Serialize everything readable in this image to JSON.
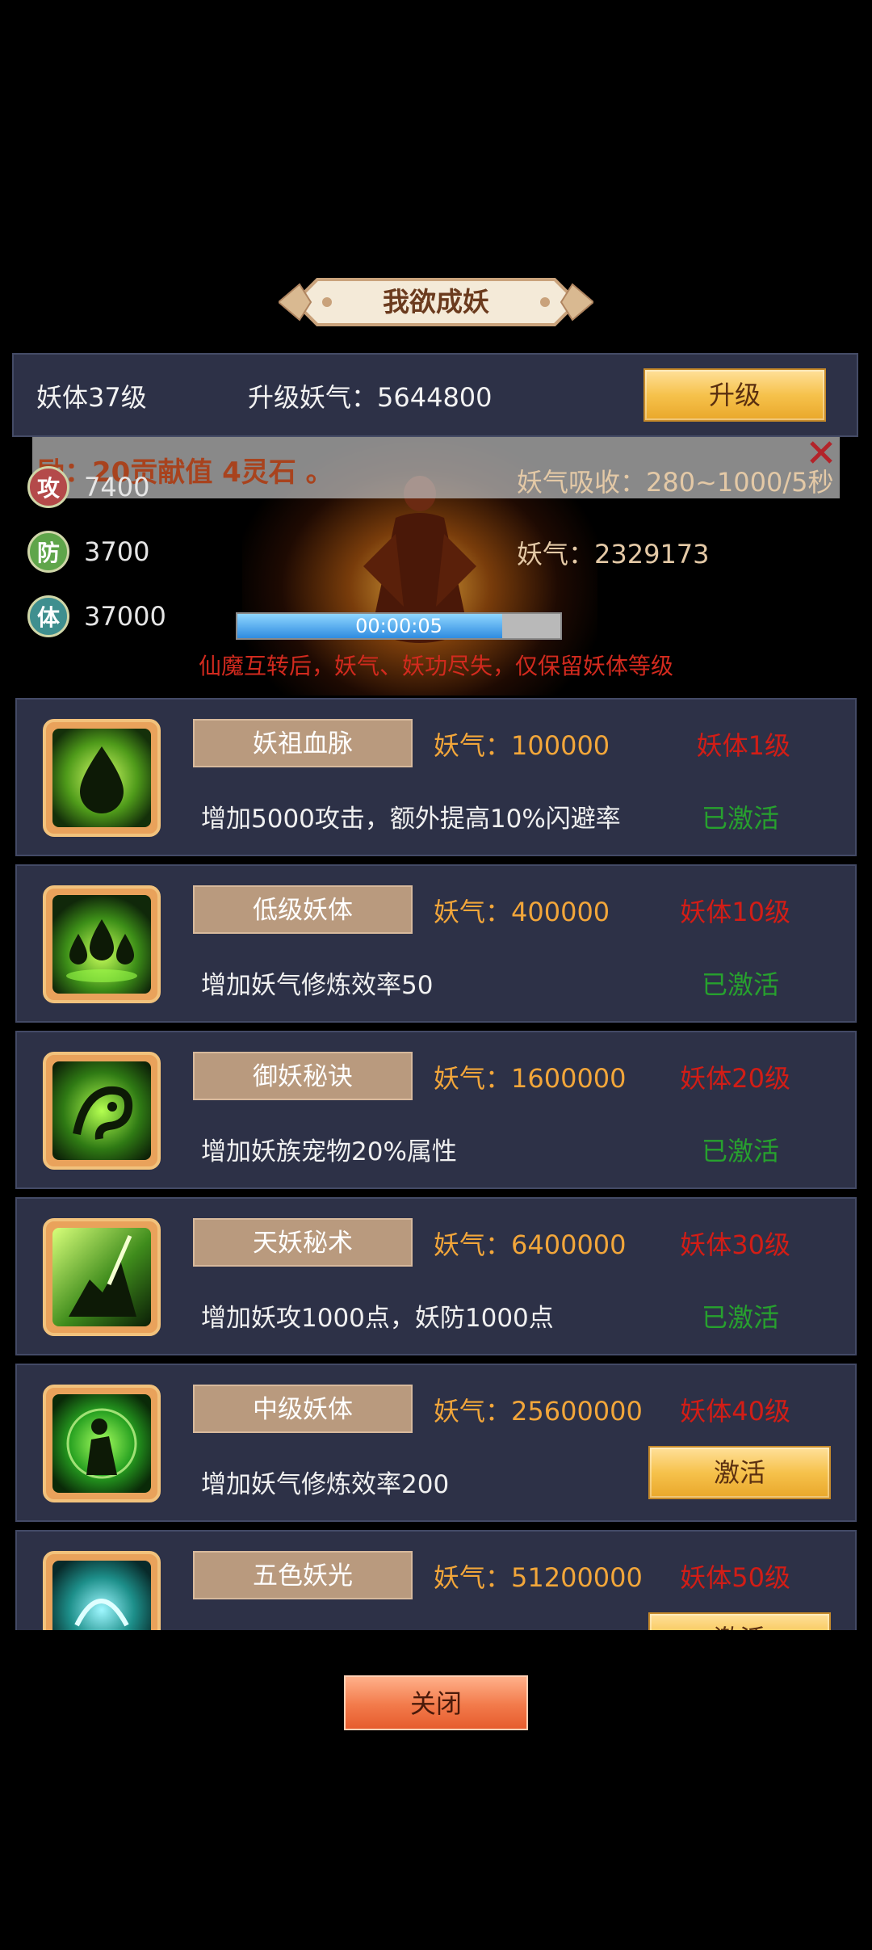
{
  "title": "我欲成妖",
  "level": {
    "current": "妖体37级",
    "upgrade_cost": "升级妖气：5644800",
    "upgrade_label": "升级"
  },
  "notice": {
    "text": "励：20贡献值 4灵石 。"
  },
  "stats": [
    {
      "badge": "攻",
      "value": "7400",
      "color": "#b44a4a"
    },
    {
      "badge": "防",
      "value": "3700",
      "color": "#5fa54a"
    },
    {
      "badge": "体",
      "value": "37000",
      "color": "#3f8f8f"
    }
  ],
  "absorb": "妖气吸收：280~1000/5秒",
  "energy": "妖气：2329173",
  "progress": {
    "time": "00:00:05",
    "fraction": 0.82
  },
  "warning": "仙魔互转后，妖气、妖功尽失，仅保留妖体等级",
  "skills": [
    {
      "name": "妖祖血脉",
      "cost": "妖气：100000",
      "req": "妖体1级",
      "desc": "增加5000攻击，额外提高10%闪避率",
      "status": "已激活",
      "activated": true
    },
    {
      "name": "低级妖体",
      "cost": "妖气：400000",
      "req": "妖体10级",
      "desc": "增加妖气修炼效率50",
      "status": "已激活",
      "activated": true
    },
    {
      "name": "御妖秘诀",
      "cost": "妖气：1600000",
      "req": "妖体20级",
      "desc": "增加妖族宠物20%属性",
      "status": "已激活",
      "activated": true
    },
    {
      "name": "天妖秘术",
      "cost": "妖气：6400000",
      "req": "妖体30级",
      "desc": "增加妖攻1000点，妖防1000点",
      "status": "已激活",
      "activated": true
    },
    {
      "name": "中级妖体",
      "cost": "妖气：25600000",
      "req": "妖体40级",
      "desc": "增加妖气修炼效率200",
      "status": "激活",
      "activated": false
    },
    {
      "name": "五色妖光",
      "cost": "妖气：51200000",
      "req": "妖体50级",
      "desc": "",
      "status": "激活",
      "activated": false
    }
  ],
  "close_label": "关闭",
  "icons": [
    "skill-drop-icon",
    "skill-triple-drop-icon",
    "skill-beast-icon",
    "skill-shadow-icon",
    "skill-silhouette-icon",
    "skill-spirit-icon"
  ]
}
